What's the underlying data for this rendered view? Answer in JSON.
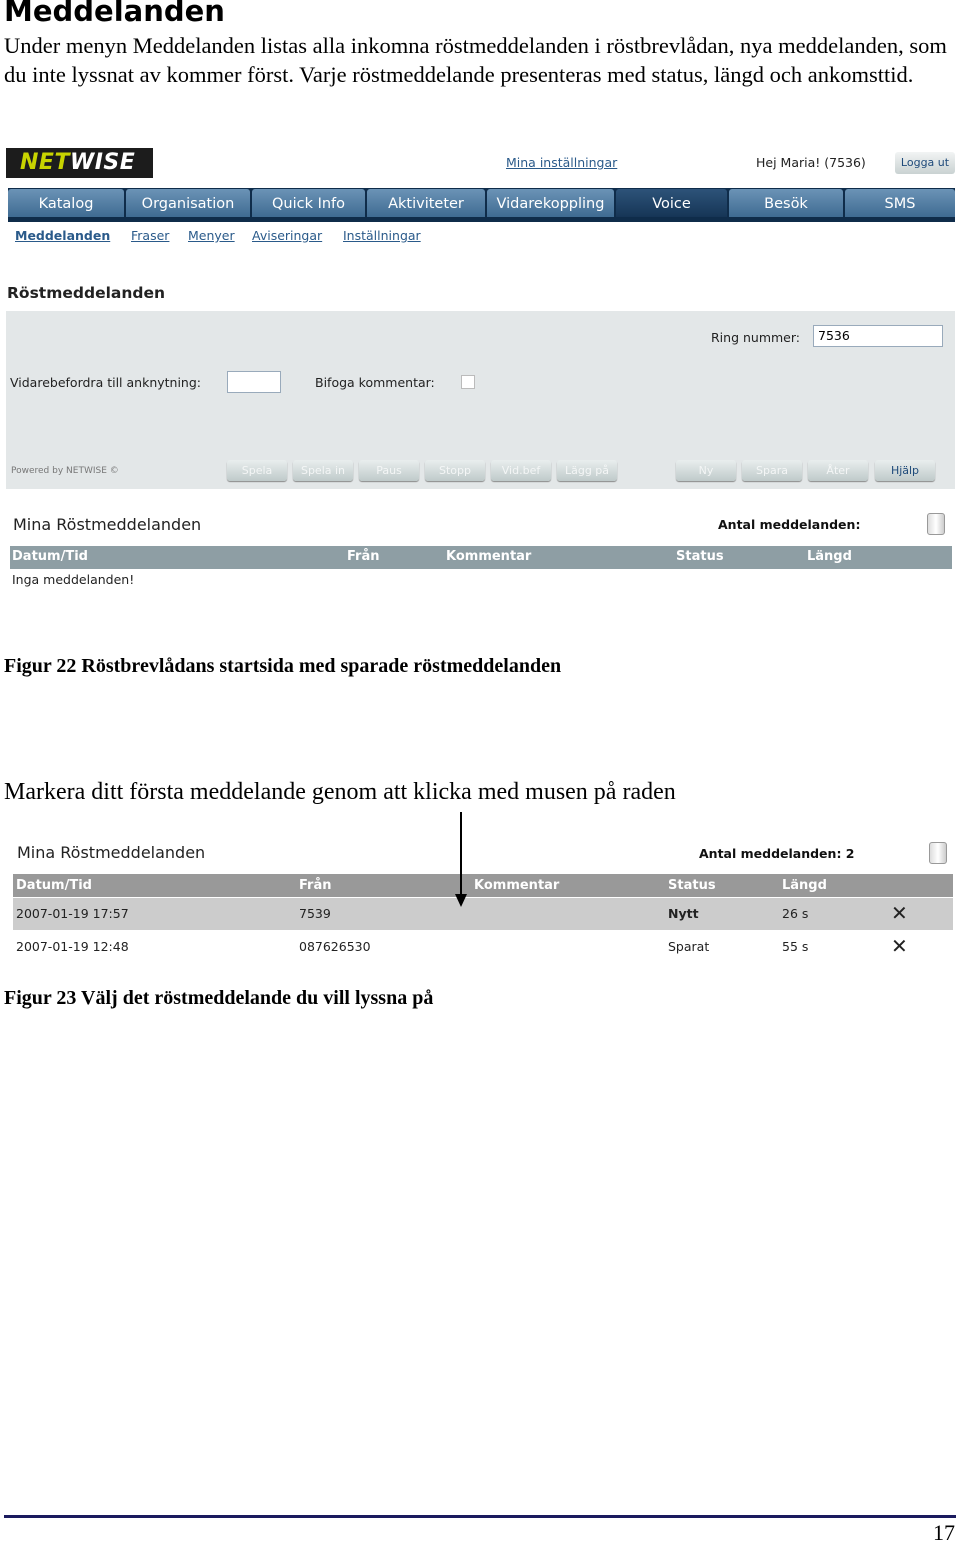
{
  "doc": {
    "heading": "Meddelanden",
    "paragraph": "Under menyn Meddelanden listas alla inkomna röstmeddelanden i röstbrevlådan, nya meddelanden, som du inte lyssnat av kommer först. Varje röstmeddelande presenteras med status, längd och ankomsttid.",
    "figure22_caption": "Figur 22  Röstbrevlådans startsida med sparade röstmeddelanden",
    "instruction": "Markera ditt första meddelande genom att klicka med musen på raden",
    "figure23_caption": "Figur 23  Välj det röstmeddelande du vill lyssna på",
    "page_number": "17"
  },
  "app": {
    "logo_a": "NET",
    "logo_b": "WISE",
    "settings_link": "Mina inställningar",
    "greeting": "Hej Maria! (7536)",
    "logout": "Logga ut",
    "tabs": [
      "Katalog",
      "Organisation",
      "Quick Info",
      "Aktiviteter",
      "Vidarekoppling",
      "Voice",
      "Besök",
      "SMS"
    ],
    "active_tab": "Voice",
    "subnav": [
      "Meddelanden",
      "Fraser",
      "Menyer",
      "Aviseringar",
      "Inställningar"
    ],
    "section_title": "Röstmeddelanden",
    "ring_label": "Ring nummer:",
    "ring_value": "7536",
    "forward_label": "Vidarebefordra till anknytning:",
    "forward_value": "",
    "comment_label": "Bifoga kommentar:",
    "powered": "Powered by NETWISE ©",
    "player_buttons": [
      "Spela",
      "Spela in",
      "Paus",
      "Stopp",
      "Vid.bef",
      "Lägg på"
    ],
    "action_buttons": [
      "Ny",
      "Spara",
      "Åter",
      "Hjälp"
    ],
    "list_title": "Mina Röstmeddelanden",
    "count_label": "Antal meddelanden:",
    "columns": [
      "Datum/Tid",
      "Från",
      "Kommentar",
      "Status",
      "Längd"
    ],
    "empty": "Inga meddelanden!"
  },
  "fig23": {
    "list_title": "Mina Röstmeddelanden",
    "count_label": "Antal meddelanden: 2",
    "columns": [
      "Datum/Tid",
      "Från",
      "Kommentar",
      "Status",
      "Längd"
    ],
    "rows": [
      {
        "datetime": "2007-01-19 17:57",
        "from": "7539",
        "comment": "",
        "status": "Nytt",
        "length": "26 s"
      },
      {
        "datetime": "2007-01-19 12:48",
        "from": "087626530",
        "comment": "",
        "status": "Sparat",
        "length": "55 s"
      }
    ]
  },
  "colors": {
    "nav": "#0f2c4a",
    "tab": "#4f7aa0",
    "panel": "#e3e7e8",
    "table_header": "#8e9ea4",
    "selected_row": "#cccccc",
    "footer_rule": "#1a1a5e"
  }
}
